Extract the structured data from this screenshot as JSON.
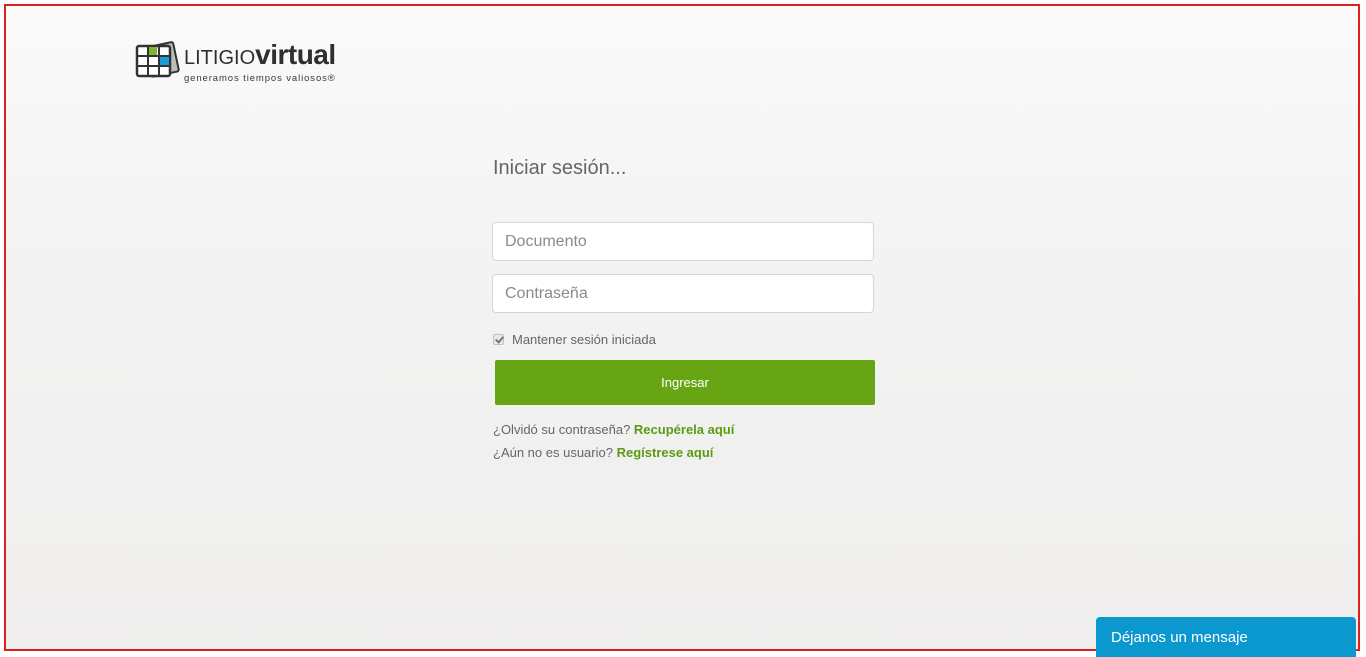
{
  "logo": {
    "word_light": "LITIGIO",
    "word_bold": "virtual",
    "tagline": "generamos tiempos valiosos®"
  },
  "login": {
    "title": "Iniciar sesión...",
    "document_placeholder": "Documento",
    "document_value": "",
    "password_placeholder": "Contraseña",
    "password_value": "",
    "remember_label": "Mantener sesión iniciada",
    "remember_checked": true,
    "submit_label": "Ingresar"
  },
  "links": {
    "forgot_prompt": "¿Olvidó su contraseña?",
    "forgot_link": "Recupérela aquí",
    "register_prompt": "¿Aún no es usuario?",
    "register_link": "Regístrese aquí"
  },
  "chat": {
    "label": "Déjanos un mensaje"
  },
  "colors": {
    "accent_green": "#68a514",
    "link_green": "#5c9a14",
    "chat_blue": "#0a98cf",
    "frame_red": "#e02020"
  }
}
